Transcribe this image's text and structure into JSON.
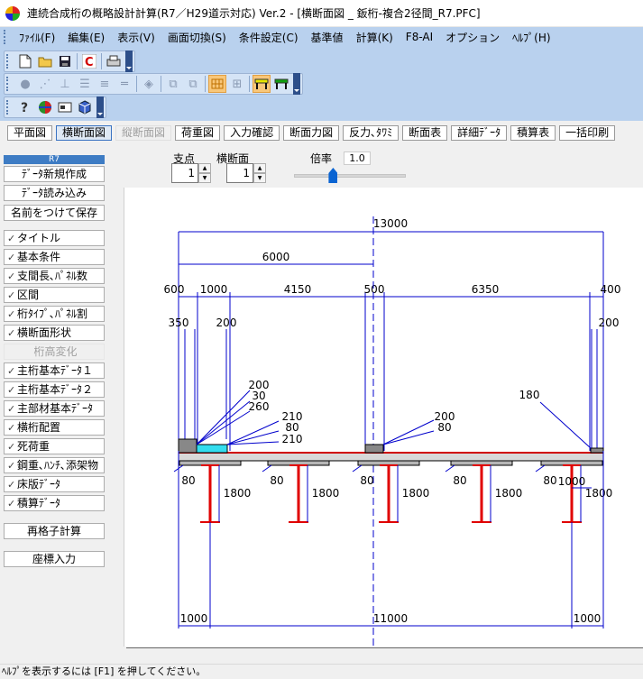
{
  "window": {
    "title": "連続合成桁の概略設計計算(R7／H29道示対応) Ver.2 - [横断面図 _ 鈑桁-複合2径間_R7.PFC]"
  },
  "menu": [
    "ﾌｧｲﾙ(F)",
    "編集(E)",
    "表示(V)",
    "画面切換(S)",
    "条件設定(C)",
    "基準値",
    "計算(K)",
    "F8-AI",
    "オプション",
    "ﾍﾙﾌﾟ(H)"
  ],
  "toolbar_icons": {
    "row1": [
      "new-file-icon",
      "open-folder-icon",
      "save-icon",
      "calc-c-icon",
      "print-icon"
    ],
    "row2": [
      "tool-a-icon",
      "tool-b-icon",
      "tool-c-icon",
      "tool-d-icon",
      "tool-e-icon",
      "tool-f-icon",
      "tool-g-icon",
      "tool-h-icon",
      "tool-grid-icon",
      "tool-book-icon",
      "girder-section-icon",
      "girder-section-green-icon"
    ],
    "row3": [
      "help-icon",
      "globe-icon",
      "card-icon",
      "cube-icon"
    ]
  },
  "view_tabs": [
    {
      "label": "平面図",
      "state": "normal"
    },
    {
      "label": "横断面図",
      "state": "selected"
    },
    {
      "label": "縦断面図",
      "state": "disabled"
    },
    {
      "label": "荷重図",
      "state": "normal"
    },
    {
      "label": "入力確認",
      "state": "normal"
    },
    {
      "label": "断面力図",
      "state": "normal"
    },
    {
      "label": "反力､ﾀﾜﾐ",
      "state": "normal"
    },
    {
      "label": "断面表",
      "state": "normal"
    },
    {
      "label": "詳細ﾃﾞｰﾀ",
      "state": "normal"
    },
    {
      "label": "積算表",
      "state": "normal"
    },
    {
      "label": "一括印刷",
      "state": "normal"
    }
  ],
  "sidebar": {
    "header": "R7",
    "file_buttons": [
      "ﾃﾞｰﾀ新規作成",
      "ﾃﾞｰﾀ読み込み",
      "名前をつけて保存"
    ],
    "items": [
      {
        "label": "タイトル",
        "checked": true,
        "disabled": false
      },
      {
        "label": "基本条件",
        "checked": true,
        "disabled": false
      },
      {
        "label": "支間長､ﾊﾟﾈﾙ数",
        "checked": true,
        "disabled": false
      },
      {
        "label": "区間",
        "checked": true,
        "disabled": false
      },
      {
        "label": "桁ﾀｲﾌﾟ､ﾊﾟﾈﾙ割",
        "checked": true,
        "disabled": false
      },
      {
        "label": "横断面形状",
        "checked": true,
        "disabled": false
      },
      {
        "label": "桁高変化",
        "checked": false,
        "disabled": true
      },
      {
        "label": "主桁基本ﾃﾞｰﾀ１",
        "checked": true,
        "disabled": false
      },
      {
        "label": "主桁基本ﾃﾞｰﾀ２",
        "checked": true,
        "disabled": false
      },
      {
        "label": "主部材基本ﾃﾞｰﾀ",
        "checked": true,
        "disabled": false
      },
      {
        "label": "横桁配置",
        "checked": true,
        "disabled": false
      },
      {
        "label": "死荷重",
        "checked": true,
        "disabled": false
      },
      {
        "label": "鋼重､ﾊﾝﾁ､添架物",
        "checked": true,
        "disabled": false
      },
      {
        "label": "床版ﾃﾞｰﾀ",
        "checked": true,
        "disabled": false
      },
      {
        "label": "積算ﾃﾞｰﾀ",
        "checked": true,
        "disabled": false
      }
    ],
    "action_buttons": [
      "再格子計算",
      "座標入力"
    ]
  },
  "controls": {
    "support_label": "支点",
    "support_value": "1",
    "section_label": "横断面",
    "section_value": "1",
    "zoom_label": "倍率",
    "zoom_value": "1.0",
    "zoom_level": 0.35
  },
  "drawing": {
    "dims": {
      "total": "13000",
      "half": "6000",
      "seg": [
        "600",
        "1000",
        "4150",
        "500",
        "6350",
        "400"
      ],
      "left_h1": "350",
      "left_h2": "200",
      "right_h": "200",
      "lbl1": [
        "200",
        "30",
        "260"
      ],
      "lbl2": [
        "210",
        "80",
        "210"
      ],
      "lbl3": [
        "200",
        "80"
      ],
      "lbl4": "180",
      "girder_h": [
        "1800",
        "1800",
        "1800",
        "1800",
        "1800"
      ],
      "edge80": [
        "80",
        "80",
        "80",
        "80",
        "80"
      ],
      "right_1000": "1000",
      "bottom": [
        "1000",
        "11000",
        "1000"
      ]
    },
    "colors": {
      "girder": "#e00000",
      "dim": "#0000cc",
      "slab": "#888888",
      "blue_fill": "#33ddee"
    }
  },
  "status": "ﾍﾙﾌﾟを表示するには [F1] を押してください。"
}
